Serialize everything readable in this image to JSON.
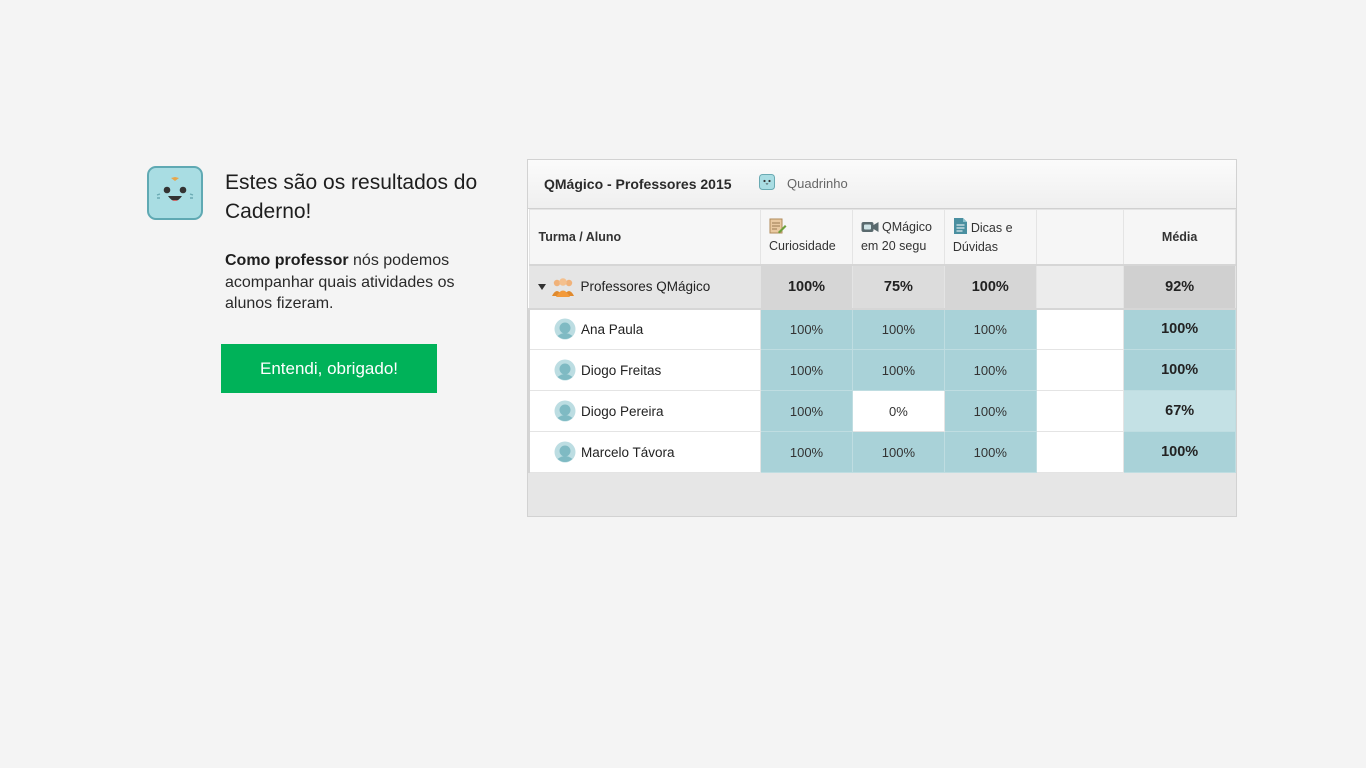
{
  "intro": {
    "mascot_icon": "notebook-mascot-icon",
    "title": "Estes são os resultados do Caderno!",
    "body_bold": "Como professor",
    "body_rest": " nós podemos acompanhar quais atividades os alunos fizeram.",
    "button_label": "Entendi, obrigado!",
    "button_color": "#00b259"
  },
  "panel": {
    "title": "QMágico - Professores 2015",
    "notebook_icon": "quadrinho-icon",
    "notebook_label": "Quadrinho",
    "columns": {
      "student": "Turma / Aluno",
      "activities": [
        {
          "icon": "text-activity-icon",
          "label": "Curiosidade"
        },
        {
          "icon": "video-activity-icon",
          "label": "QMágico em 20 segu"
        },
        {
          "icon": "document-activity-icon",
          "label": "Dicas e Dúvidas"
        }
      ],
      "average": "Média"
    },
    "group": {
      "name": "Professores QMágico",
      "icon": "group-users-icon",
      "scores": [
        "100%",
        "75%",
        "100%"
      ],
      "average": "92%"
    },
    "students": [
      {
        "name": "Ana Paula",
        "scores": [
          "100%",
          "100%",
          "100%"
        ],
        "average": "100%"
      },
      {
        "name": "Diogo Freitas",
        "scores": [
          "100%",
          "100%",
          "100%"
        ],
        "average": "100%"
      },
      {
        "name": "Diogo Pereira",
        "scores": [
          "100%",
          "0%",
          "100%"
        ],
        "average": "67%"
      },
      {
        "name": "Marcelo Távora",
        "scores": [
          "100%",
          "100%",
          "100%"
        ],
        "average": "100%"
      }
    ],
    "colors": {
      "complete": "#a9d2d8",
      "partial": "#c4e1e5",
      "none": "#ffffff"
    }
  }
}
